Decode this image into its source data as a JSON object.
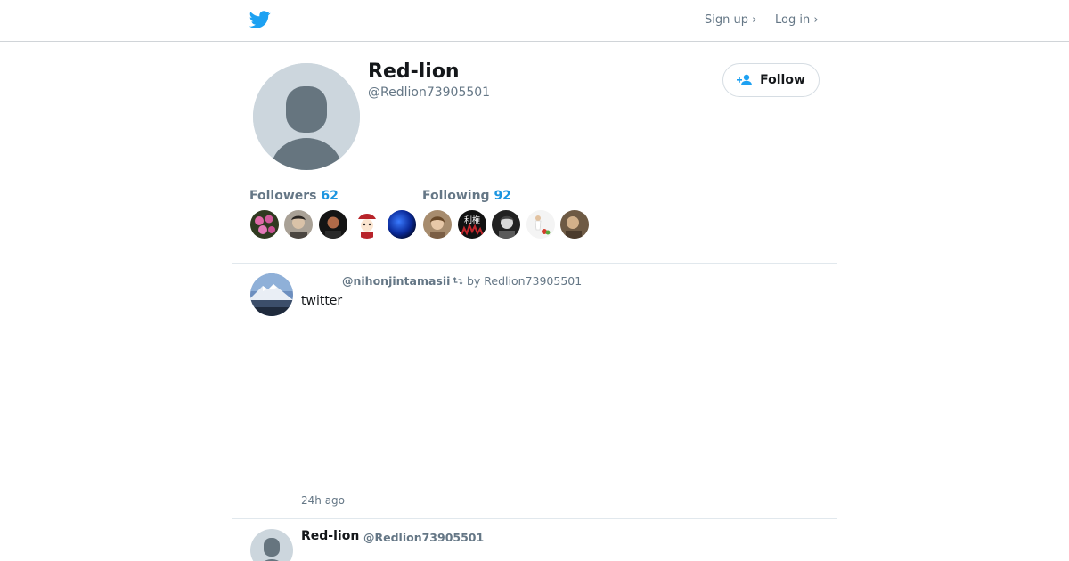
{
  "header": {
    "logo_icon": "bird-logo-icon",
    "signup_label": "Sign up ›",
    "login_label": "Log in ›",
    "brand_color": "#1da1f2"
  },
  "profile": {
    "display_name": "Red-lion",
    "handle": "@Redlion73905501",
    "avatar_icon": "default-avatar-icon",
    "follow_label": "Follow",
    "follow_icon": "add-person-icon"
  },
  "stats": {
    "followers_label": "Followers",
    "followers_count": "62",
    "following_label": "Following",
    "following_count": "92",
    "accent_color": "#1b95e0"
  },
  "follower_avatars": [
    "pink-flower-avatar",
    "person-avatar",
    "dark-portrait-avatar",
    "cartoon-avatar",
    "blue-sphere-avatar"
  ],
  "following_avatars": [
    "woman-portrait-avatar",
    "kanji-text-avatar",
    "bw-portrait-avatar",
    "figure-avatar",
    "sepia-avatar"
  ],
  "following_avatar_text": "利権",
  "tweets": [
    {
      "retweeted_handle": "@nihonjintamasii",
      "retweet_icon": "retweet-icon",
      "retweet_by": "by Redlion73905501",
      "text": "twitter",
      "time": "24h ago"
    },
    {
      "name": "Red-lion",
      "handle": "@Redlion73905501"
    }
  ]
}
